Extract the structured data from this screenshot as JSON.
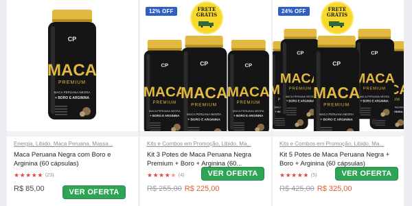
{
  "products": [
    {
      "category": "Energia, Libido, Maca Peruana, Massa...",
      "title": "Maca Peruana Negra com Boro e Arginina (60 cápsulas)",
      "rating_count": "(23)",
      "rating_value": 5,
      "old_price": "",
      "price": "R$ 85,00",
      "cta": "VER OFERTA",
      "badge": ""
    },
    {
      "category": "Kits e Combos em Promoção, Libido, Ma...",
      "title": "Kit 3 Potes de Maca Peruana Negra Premium + Boro + Arginina (60...",
      "rating_count": "(4)",
      "rating_value": 4.5,
      "old_price": "R$ 255,00",
      "price": "R$ 225,00",
      "cta": "VER OFERTA",
      "badge": "12% OFF",
      "frete_l1": "FRETE",
      "frete_l2": "GRÁTIS"
    },
    {
      "category": "Kits e Combos em Promoção, Libido, Ma...",
      "title": "Kit 5 Potes de Maca Peruana Negra + Boro + Arginina (60 cápsulas)",
      "rating_count": "(5)",
      "rating_value": 5,
      "old_price": "R$ 425,00",
      "price": "R$ 325,00",
      "cta": "VER OFERTA",
      "badge": "24% OFF",
      "frete_l1": "FRETE",
      "frete_l2": "GRÁTIS"
    }
  ],
  "jar_label": {
    "brand_mark": "CP",
    "name": "MACA",
    "sub": "PREMIUM",
    "line1": "MACA PERUANA NEGRA",
    "line2": "+ BORO E ARGININA"
  },
  "colors": {
    "cta_green": "#2ea455",
    "badge_blue": "#2f5fc2",
    "frete_yellow": "#f8d92a",
    "star_red": "#e4453a",
    "price_orange": "#e45b2a",
    "jar_gold": "#e2b93f"
  }
}
